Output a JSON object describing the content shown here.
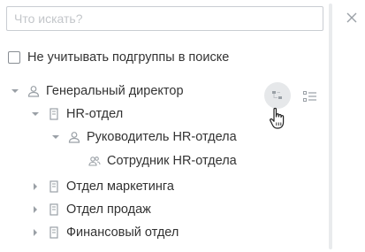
{
  "search": {
    "placeholder": "Что искать?"
  },
  "options": {
    "exclude_subgroups_label": "Не учитывать подгруппы в поиске"
  },
  "tree": {
    "general_director": "Генеральный директор",
    "hr_department": "HR-отдел",
    "hr_head": "Руководитель HR-отдела",
    "hr_employee": "Сотрудник HR-отдела",
    "marketing": "Отдел маркетинга",
    "sales": "Отдел продаж",
    "finance": "Финансовый отдел"
  },
  "icons": {
    "close": "close-icon",
    "person": "person-icon",
    "group": "group-icon",
    "department": "building-icon",
    "expanded": "triangle-down-icon",
    "collapsed": "triangle-right-icon",
    "show_structure": "structure-icon",
    "show_list": "list-icon",
    "cursor": "hand-pointer-icon"
  },
  "colors": {
    "icon": "#9aa0a6",
    "text": "#333333",
    "border": "#c9cdd2",
    "hover_bg": "#e6e8ea"
  }
}
